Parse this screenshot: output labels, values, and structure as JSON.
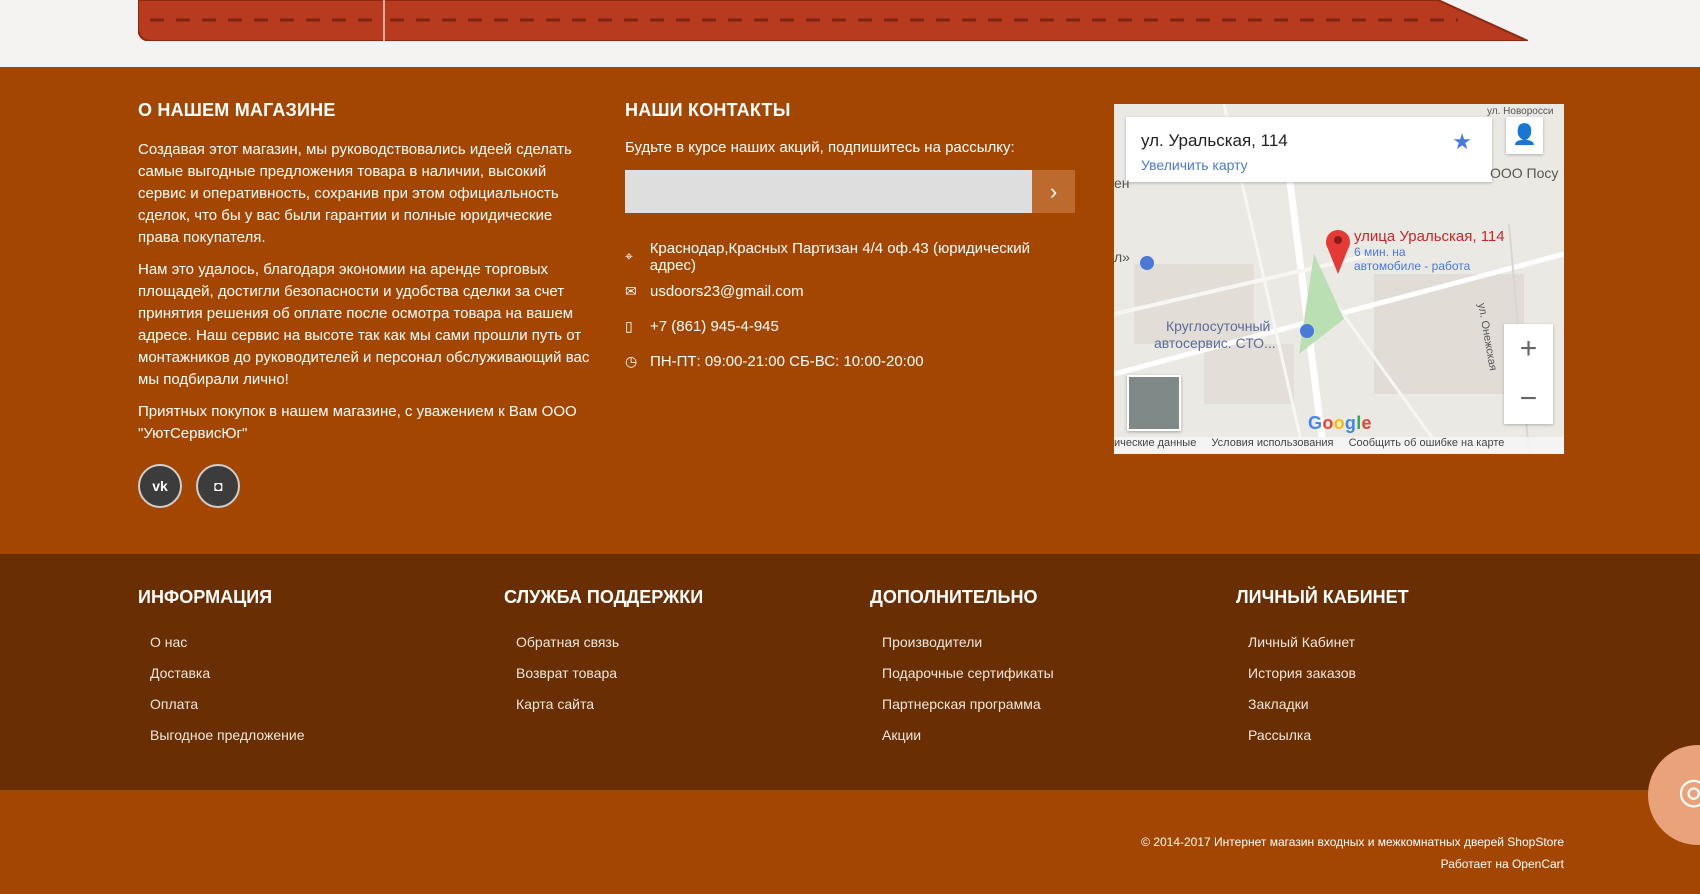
{
  "about": {
    "title": "О НАШЕМ МАГАЗИНЕ",
    "paragraphs": [
      "Создавая этот магазин, мы руководствовались идеей сделать самые выгодные предложения товара в наличии, высокий сервис и оперативность, сохранив при этом официальность сделок, что бы у вас были гарантии и полные юридические права покупателя.",
      "Нам это удалось, благодаря экономии на аренде торговых площадей, достигли безопасности и удобства сделки за счет принятия решения об оплате после осмотра товара на вашем адресе. Наш сервис на высоте так как мы сами прошли путь от монтажников до руководителей и персонал обслуживающий вас мы подбирали лично!",
      "Приятных покупок в нашем магазине, с уважением к Вам ООО \"УютСервисЮг\""
    ],
    "social": [
      {
        "icon": "vk-icon",
        "glyph": "vk"
      },
      {
        "icon": "instagram-icon",
        "glyph": "◘"
      }
    ]
  },
  "contacts": {
    "title": "НАШИ КОНТАКТЫ",
    "subscribe_text": "Будьте в курсе наших акций, подпишитесь на рассылку:",
    "subscribe_placeholder": "",
    "subscribe_button": "›",
    "address": "Краснодар,Красных Партизан 4/4 оф.43 (юридический адрес)",
    "email": "usdoors23@gmail.com",
    "phone": "+7 (861) 945-4-945",
    "hours": "ПН-ПТ: 09:00-21:00 СБ-ВС: 10:00-20:00"
  },
  "map": {
    "card_address": "ул. Уральская, 114",
    "enlarge_link": "Увеличить карту",
    "pin_label": "улица Уральская, 114",
    "pin_sub1": "6 мин. на",
    "pin_sub2": "автомобиле - работа",
    "poi_label1": "Круглосуточный",
    "poi_label2": "автосервис. СТО...",
    "street_top": "ул. Новоросси",
    "street_right": "ул. Онежская",
    "poi_right": "ООО Посу",
    "edge_left1": "ен",
    "edge_left2": "л»",
    "google": "Google",
    "footer_items": [
      "ические данные",
      "Условия использования",
      "Сообщить об ошибке на карте"
    ]
  },
  "links": {
    "columns": [
      {
        "title": "ИНФОРМАЦИЯ",
        "items": [
          "О нас",
          "Доставка",
          "Оплата",
          "Выгодное предложение"
        ]
      },
      {
        "title": "СЛУЖБА ПОДДЕРЖКИ",
        "items": [
          "Обратная связь",
          "Возврат товара",
          "Карта сайта"
        ]
      },
      {
        "title": "ДОПОЛНИТЕЛЬНО",
        "items": [
          "Производители",
          "Подарочные сертификаты",
          "Партнерская программа",
          "Акции"
        ]
      },
      {
        "title": "ЛИЧНЫЙ КАБИНЕТ",
        "items": [
          "Личный Кабинет",
          "История заказов",
          "Закладки",
          "Рассылка"
        ]
      }
    ]
  },
  "copyright": {
    "line1": "© 2014-2017 Интернет магазин входных и межкомнатных дверей ShopStore",
    "line2": "Работает на OpenCart"
  },
  "colors": {
    "footer_main": "#a24602",
    "footer_links": "#6a2e03",
    "ribbon": "#b83a1f"
  }
}
